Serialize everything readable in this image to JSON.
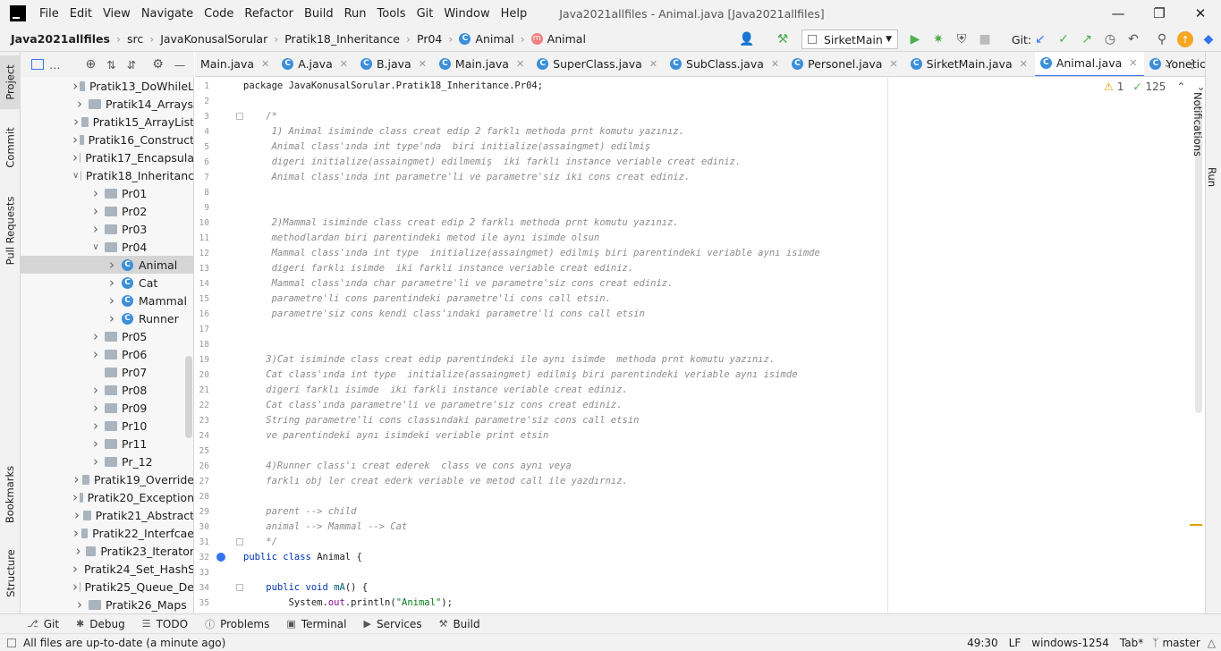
{
  "menu": {
    "items": [
      "File",
      "Edit",
      "View",
      "Navigate",
      "Code",
      "Refactor",
      "Build",
      "Run",
      "Tools",
      "Git",
      "Window",
      "Help"
    ],
    "window_title": "Java2021allfiles - Animal.java [Java2021allfiles]"
  },
  "breadcrumb": {
    "project": "Java2021allfiles",
    "src": "src",
    "p1": "JavaKonusalSorular",
    "p2": "Pratik18_Inheritance",
    "p3": "Pr04",
    "cls": "Animal",
    "method": "Animal"
  },
  "toolbar": {
    "run_config": "SirketMain",
    "git_label": "Git:"
  },
  "side_tabs": {
    "project": "Project",
    "commit": "Commit",
    "pull_requests": "Pull Requests",
    "bookmarks": "Bookmarks",
    "structure": "Structure",
    "notifications": "Notifications",
    "run": "Run"
  },
  "tree": [
    {
      "label": "Pratik13_DoWhileL",
      "kind": "folder",
      "depth": 1,
      "arrow": "closed"
    },
    {
      "label": "Pratik14_Arrays",
      "kind": "folder",
      "depth": 1,
      "arrow": "closed"
    },
    {
      "label": "Pratik15_ArrayList",
      "kind": "folder",
      "depth": 1,
      "arrow": "closed"
    },
    {
      "label": "Pratik16_Construct",
      "kind": "folder",
      "depth": 1,
      "arrow": "closed"
    },
    {
      "label": "Pratik17_Encapsula",
      "kind": "folder",
      "depth": 1,
      "arrow": "closed"
    },
    {
      "label": "Pratik18_Inheritanc",
      "kind": "folder",
      "depth": 1,
      "arrow": "open"
    },
    {
      "label": "Pr01",
      "kind": "folder",
      "depth": 2,
      "arrow": "closed"
    },
    {
      "label": "Pr02",
      "kind": "folder",
      "depth": 2,
      "arrow": "closed"
    },
    {
      "label": "Pr03",
      "kind": "folder",
      "depth": 2,
      "arrow": "closed"
    },
    {
      "label": "Pr04",
      "kind": "folder",
      "depth": 2,
      "arrow": "open"
    },
    {
      "label": "Animal",
      "kind": "class",
      "depth": 3,
      "arrow": "closed",
      "selected": true
    },
    {
      "label": "Cat",
      "kind": "class",
      "depth": 3,
      "arrow": "closed"
    },
    {
      "label": "Mammal",
      "kind": "class",
      "depth": 3,
      "arrow": "closed"
    },
    {
      "label": "Runner",
      "kind": "class",
      "depth": 3,
      "arrow": "closed"
    },
    {
      "label": "Pr05",
      "kind": "folder",
      "depth": 2,
      "arrow": "closed"
    },
    {
      "label": "Pr06",
      "kind": "folder",
      "depth": 2,
      "arrow": "closed"
    },
    {
      "label": "Pr07",
      "kind": "folder",
      "depth": 2,
      "arrow": "none"
    },
    {
      "label": "Pr08",
      "kind": "folder",
      "depth": 2,
      "arrow": "closed"
    },
    {
      "label": "Pr09",
      "kind": "folder",
      "depth": 2,
      "arrow": "closed"
    },
    {
      "label": "Pr10",
      "kind": "folder",
      "depth": 2,
      "arrow": "closed"
    },
    {
      "label": "Pr11",
      "kind": "folder",
      "depth": 2,
      "arrow": "closed"
    },
    {
      "label": "Pr_12",
      "kind": "folder",
      "depth": 2,
      "arrow": "closed"
    },
    {
      "label": "Pratik19_Override",
      "kind": "folder",
      "depth": 1,
      "arrow": "closed"
    },
    {
      "label": "Pratik20_Exception",
      "kind": "folder",
      "depth": 1,
      "arrow": "closed"
    },
    {
      "label": "Pratik21_Abstract",
      "kind": "folder",
      "depth": 1,
      "arrow": "closed"
    },
    {
      "label": "Pratik22_Interfcae",
      "kind": "folder",
      "depth": 1,
      "arrow": "closed"
    },
    {
      "label": "Pratik23_Iterator",
      "kind": "folder",
      "depth": 1,
      "arrow": "closed"
    },
    {
      "label": "Pratik24_Set_HashS",
      "kind": "folder",
      "depth": 1,
      "arrow": "closed"
    },
    {
      "label": "Pratik25_Queue_De",
      "kind": "folder",
      "depth": 1,
      "arrow": "closed"
    },
    {
      "label": "Pratik26_Maps",
      "kind": "folder",
      "depth": 1,
      "arrow": "closed"
    }
  ],
  "tabs": [
    {
      "label": "Main.java",
      "icon": "none"
    },
    {
      "label": "A.java",
      "icon": "class"
    },
    {
      "label": "B.java",
      "icon": "class"
    },
    {
      "label": "Main.java",
      "icon": "class-run"
    },
    {
      "label": "SuperClass.java",
      "icon": "class"
    },
    {
      "label": "SubClass.java",
      "icon": "class-run"
    },
    {
      "label": "Personel.java",
      "icon": "class"
    },
    {
      "label": "SirketMain.java",
      "icon": "class-run"
    },
    {
      "label": "Animal.java",
      "icon": "class",
      "active": true
    },
    {
      "label": "Yonetici.java",
      "icon": "class"
    }
  ],
  "inspection": {
    "warnings": "1",
    "ok": "125"
  },
  "code_lines": [
    [
      {
        "t": "package JavaKonusalSorular.Pratik18_Inheritance.Pr04;",
        "c": ""
      }
    ],
    [],
    [
      {
        "t": "    /*",
        "c": "cm"
      }
    ],
    [
      {
        "t": "     1) Animal isiminde class creat edip 2 farklı methoda prnt komutu yazınız.",
        "c": "cm"
      }
    ],
    [
      {
        "t": "     Animal class'ında int type'nda  biri initialize(assaingmet) edilmiş",
        "c": "cm"
      }
    ],
    [
      {
        "t": "     digeri initialize(assaingmet) edilmemiş  iki farkli instance veriable creat ediniz.",
        "c": "cm"
      }
    ],
    [
      {
        "t": "     Animal class'ında int parametre'li ve parametre'siz iki cons creat ediniz.",
        "c": "cm"
      }
    ],
    [],
    [],
    [
      {
        "t": "     2)Mammal isiminde class creat edip 2 farklı methoda prnt komutu yazınız.",
        "c": "cm"
      }
    ],
    [
      {
        "t": "     methodlardan biri parentindeki metod ile aynı isimde olsun",
        "c": "cm"
      }
    ],
    [
      {
        "t": "     Mammal class'ında int type  initialize(assaingmet) edilmiş biri parentindeki veriable aynı isimde",
        "c": "cm"
      }
    ],
    [
      {
        "t": "     digeri farklı isimde  iki farkli instance veriable creat ediniz.",
        "c": "cm"
      }
    ],
    [
      {
        "t": "     Mammal class'ında char parametre'li ve parametre'siz cons creat ediniz.",
        "c": "cm"
      }
    ],
    [
      {
        "t": "     parametre'li cons parentindeki parametre'li cons call etsin.",
        "c": "cm"
      }
    ],
    [
      {
        "t": "     parametre'siz cons kendi class'ındaki parametre'li cons call etsin",
        "c": "cm"
      }
    ],
    [],
    [],
    [
      {
        "t": "    3)Cat isiminde class creat edip parentindeki ile aynı isimde  methoda prnt komutu yazınız.",
        "c": "cm"
      }
    ],
    [
      {
        "t": "    Cat class'ında int type  initialize(assaingmet) edilmiş biri parentindeki veriable aynı isimde",
        "c": "cm"
      }
    ],
    [
      {
        "t": "    digeri farklı isimde  iki farkli instance veriable creat ediniz.",
        "c": "cm"
      }
    ],
    [
      {
        "t": "    Cat class'ında parametre'li ve parametre'siz cons creat ediniz.",
        "c": "cm"
      }
    ],
    [
      {
        "t": "    String parametre'li cons classındaki parametre'siz cons call etsin",
        "c": "cm"
      }
    ],
    [
      {
        "t": "    ve parentindeki aynı isimdeki veriable print etsin",
        "c": "cm"
      }
    ],
    [],
    [
      {
        "t": "    4)Runner class'ı creat ederek  class ve cons aynı veya",
        "c": "cm"
      }
    ],
    [
      {
        "t": "    farklı obj ler creat ederk veriable ve metod call ile yazdırnız.",
        "c": "cm"
      }
    ],
    [],
    [
      {
        "t": "    parent --> child",
        "c": "cm"
      }
    ],
    [
      {
        "t": "    animal --> Mammal --> Cat",
        "c": "cm"
      }
    ],
    [
      {
        "t": "    */",
        "c": "cm"
      }
    ],
    [
      {
        "t": "public class ",
        "c": "kw"
      },
      {
        "t": "Animal {",
        "c": ""
      }
    ],
    [],
    [
      {
        "t": "    public void ",
        "c": "kw"
      },
      {
        "t": "mA",
        "c": "fn"
      },
      {
        "t": "() {",
        "c": ""
      }
    ],
    [
      {
        "t": "        System.",
        "c": ""
      },
      {
        "t": "out",
        "c": "fld"
      },
      {
        "t": ".println(",
        "c": ""
      },
      {
        "t": "\"Animal\"",
        "c": "str"
      },
      {
        "t": ");",
        "c": ""
      }
    ],
    [
      {
        "t": "    }",
        "c": ""
      }
    ]
  ],
  "bottom_tabs": [
    "Git",
    "Debug",
    "TODO",
    "Problems",
    "Terminal",
    "Services",
    "Build"
  ],
  "status": {
    "message": "All files are up-to-date (a minute ago)",
    "position": "49:30",
    "line_sep": "LF",
    "encoding": "windows-1254",
    "indent": "Tab*",
    "branch": "master"
  },
  "colors": {
    "accent": "#3574f0",
    "keyword": "#0033b3",
    "comment": "#8c8c8c",
    "string": "#067d17",
    "run": "#4caf50"
  }
}
